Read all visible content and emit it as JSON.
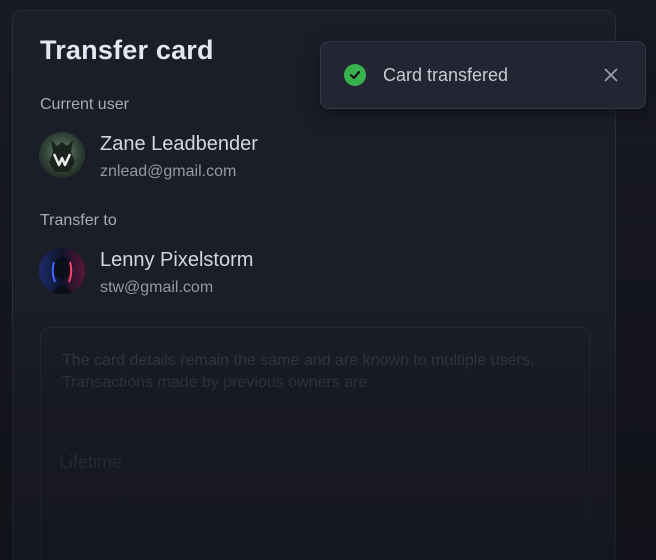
{
  "modal": {
    "title": "Transfer card",
    "current_user_label": "Current user",
    "transfer_to_label": "Transfer to",
    "current_user": {
      "name": "Zane Leadbender",
      "email": "znlead@gmail.com"
    },
    "transfer_user": {
      "name": "Lenny Pixelstorm",
      "email": "stw@gmail.com"
    },
    "info_text": "The card details remain the same and are known to multiple users. Transactions made by previous owners are",
    "lifetime_label": "Lifetime"
  },
  "toast": {
    "message": "Card transfered",
    "status_color": "#37b24d",
    "icon": "check-circle-icon",
    "close_icon": "close-icon"
  }
}
